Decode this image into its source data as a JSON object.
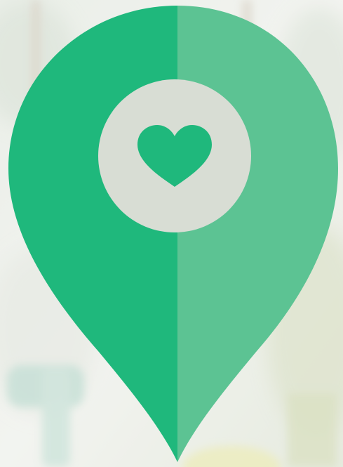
{
  "image": {
    "subject": "map-pin-heart-icon",
    "colors": {
      "pin_left": "#1fb87c",
      "pin_right": "#5cc393",
      "ring_hole": "#d8ddd4",
      "heart": "#1fb87c",
      "background": "#e6ebe3"
    }
  }
}
